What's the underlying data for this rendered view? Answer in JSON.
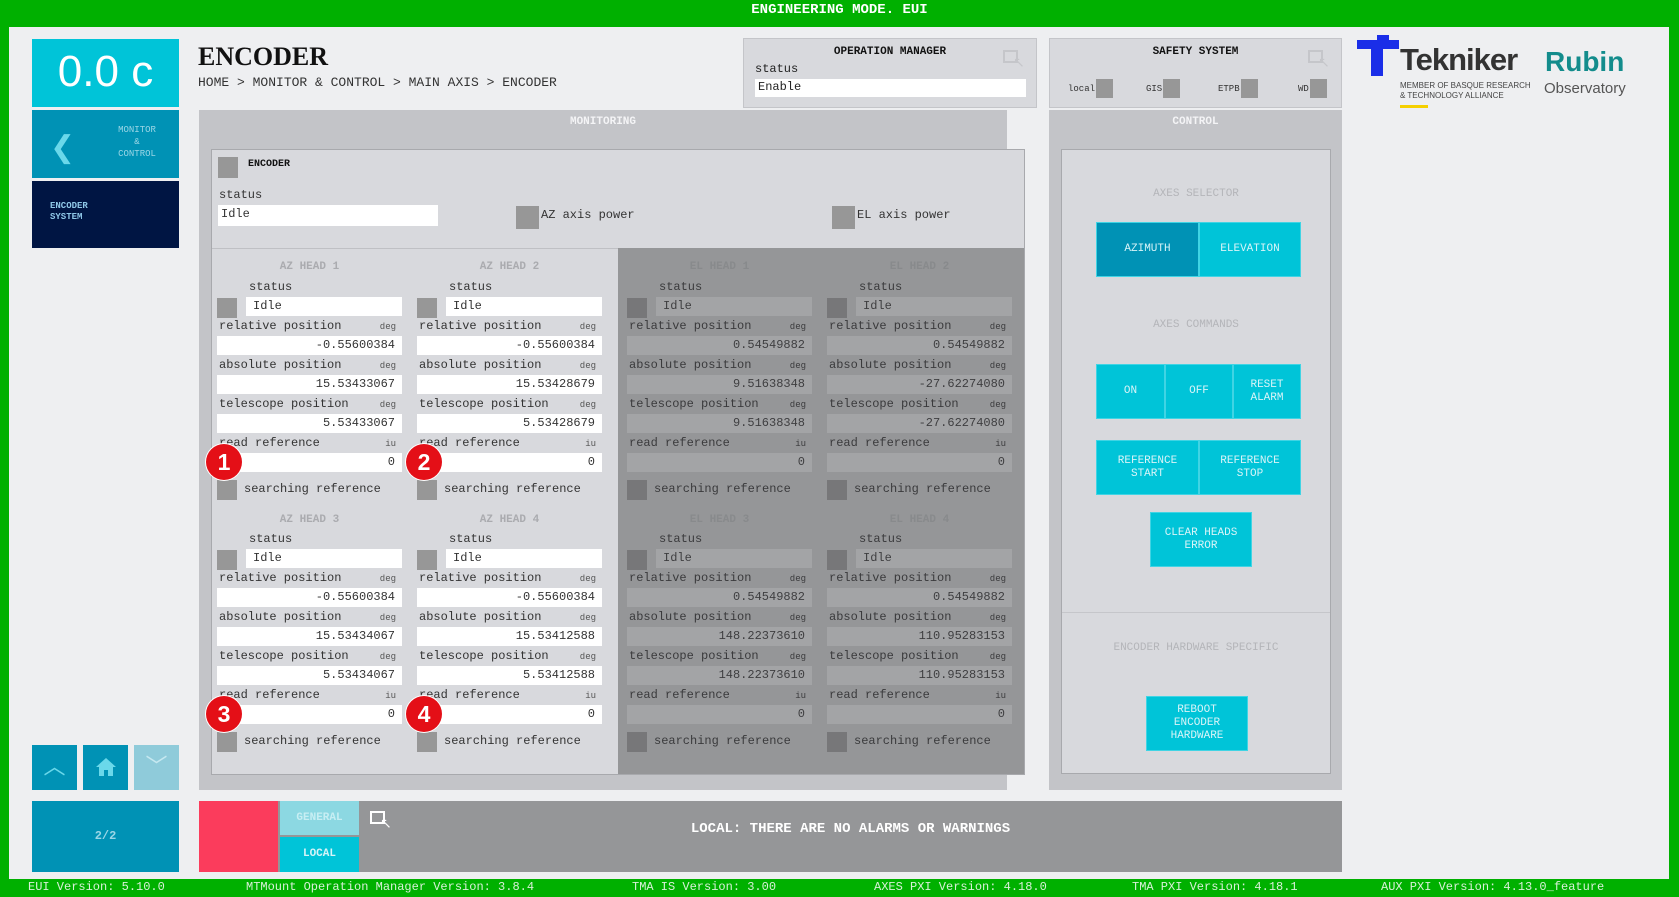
{
  "window_title": "ENGINEERING MODE. EUI",
  "sidebar": {
    "temperature": "0.0 c",
    "back_label_lines": [
      "MONITOR",
      "&",
      "CONTROL"
    ],
    "current_lines": [
      "ENCODER",
      "SYSTEM"
    ],
    "page_indicator": "2/2"
  },
  "header": {
    "title": "ENCODER",
    "breadcrumb": "HOME > MONITOR & CONTROL > MAIN AXIS > ENCODER"
  },
  "operation_manager": {
    "title": "OPERATION MANAGER",
    "status_label": "status",
    "status_value": "Enable"
  },
  "safety_system": {
    "title": "SAFETY SYSTEM",
    "indicators": [
      "local",
      "GIS",
      "ETPB",
      "WD"
    ]
  },
  "logos": {
    "tekniker": "Tekniker",
    "tekniker_sub1": "MEMBER OF BASQUE RESEARCH",
    "tekniker_sub2": "& TECHNOLOGY ALLIANCE",
    "rubin": "Rubin",
    "observatory": "Observatory"
  },
  "monitoring": {
    "title": "MONITORING",
    "encoder_label": "ENCODER",
    "status_label": "status",
    "status_value": "Idle",
    "az_power_label": "AZ axis power",
    "el_power_label": "EL axis power",
    "labels": {
      "status": "status",
      "relative": "relative position",
      "absolute": "absolute position",
      "telescope": "telescope position",
      "read_ref": "read reference",
      "searching": "searching reference",
      "deg": "deg",
      "iu": "iu"
    },
    "heads": [
      {
        "name": "AZ HEAD 1",
        "status": "Idle",
        "relative": "-0.55600384",
        "absolute": "15.53433067",
        "telescope": "5.53433067",
        "read_ref": "0",
        "badge": "1"
      },
      {
        "name": "AZ HEAD 2",
        "status": "Idle",
        "relative": "-0.55600384",
        "absolute": "15.53428679",
        "telescope": "5.53428679",
        "read_ref": "0",
        "badge": "2"
      },
      {
        "name": "EL HEAD 1",
        "status": "Idle",
        "relative": "0.54549882",
        "absolute": "9.51638348",
        "telescope": "9.51638348",
        "read_ref": "0"
      },
      {
        "name": "EL HEAD 2",
        "status": "Idle",
        "relative": "0.54549882",
        "absolute": "-27.62274080",
        "telescope": "-27.62274080",
        "read_ref": "0"
      },
      {
        "name": "AZ HEAD 3",
        "status": "Idle",
        "relative": "-0.55600384",
        "absolute": "15.53434067",
        "telescope": "5.53434067",
        "read_ref": "0",
        "badge": "3"
      },
      {
        "name": "AZ HEAD 4",
        "status": "Idle",
        "relative": "-0.55600384",
        "absolute": "15.53412588",
        "telescope": "5.53412588",
        "read_ref": "0",
        "badge": "4"
      },
      {
        "name": "EL HEAD 3",
        "status": "Idle",
        "relative": "0.54549882",
        "absolute": "148.22373610",
        "telescope": "148.22373610",
        "read_ref": "0"
      },
      {
        "name": "EL HEAD 4",
        "status": "Idle",
        "relative": "0.54549882",
        "absolute": "110.95283153",
        "telescope": "110.95283153",
        "read_ref": "0"
      }
    ]
  },
  "control": {
    "title": "CONTROL",
    "axes_selector_label": "AXES SELECTOR",
    "azimuth": "AZIMUTH",
    "elevation": "ELEVATION",
    "axes_commands_label": "AXES COMMANDS",
    "on": "ON",
    "off": "OFF",
    "reset_alarm": "RESET ALARM",
    "reference_start": "REFERENCE START",
    "reference_stop": "REFERENCE STOP",
    "clear_heads_error": "CLEAR HEADS ERROR",
    "hw_specific_label": "ENCODER HARDWARE SPECIFIC",
    "reboot": "REBOOT ENCODER HARDWARE"
  },
  "alarms": {
    "general_tab": "GENERAL",
    "local_tab": "LOCAL",
    "message": "LOCAL: THERE ARE NO ALARMS OR WARNINGS"
  },
  "versions": [
    "EUI Version: 5.10.0",
    "MTMount Operation Manager Version: 3.8.4",
    "TMA IS Version: 3.00",
    "AXES PXI Version: 4.18.0",
    "TMA PXI Version: 4.18.1",
    "AUX PXI Version: 4.13.0_feature"
  ],
  "colors": {
    "frame_green": "#00b000",
    "accent_cyan": "#00c4d8",
    "accent_blue": "#0092b5",
    "navy": "#001543",
    "alarm_red": "#fb3c5c",
    "tekniker_blue": "#1a2ee8",
    "rubin_teal": "#138c8c"
  }
}
